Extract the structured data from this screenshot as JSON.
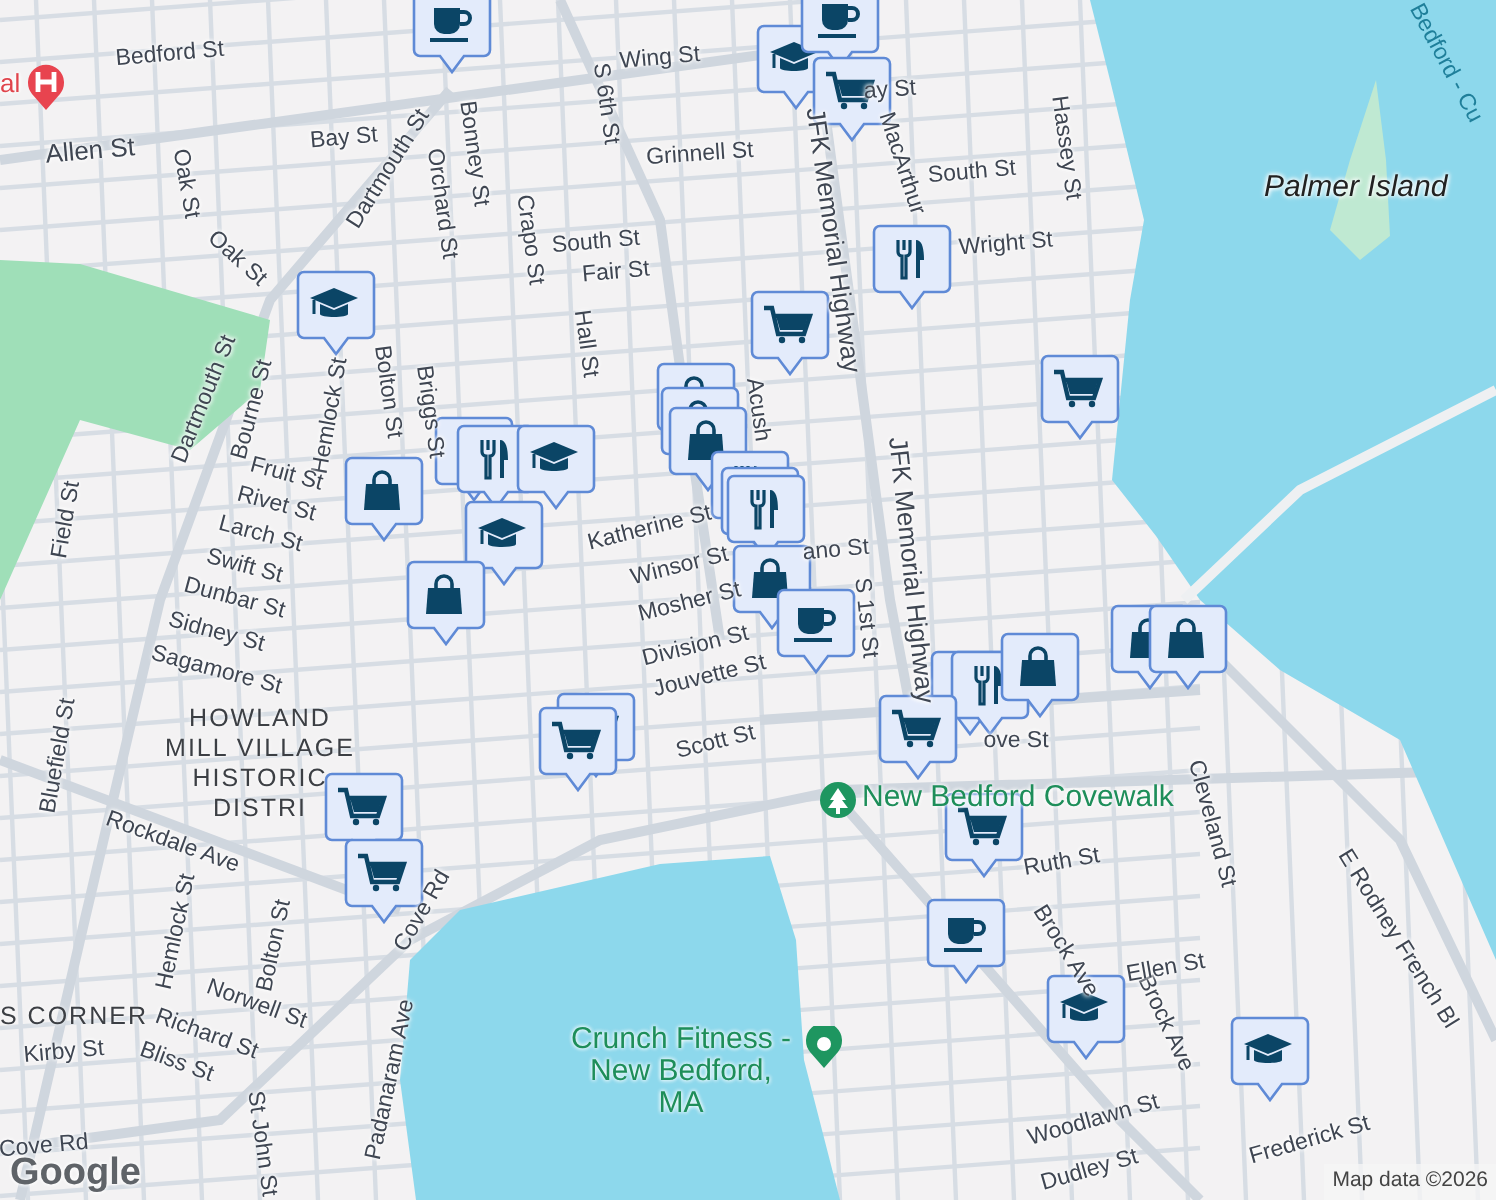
{
  "map": {
    "hospital_label": "al",
    "street_labels": [
      "Bedford St",
      "Allen St",
      "Wing St",
      "S 6th St",
      "Bay St",
      "Dartmouth St",
      "Grinnell St",
      "Oak St",
      "Orchard St",
      "Bonney St",
      "Oak St",
      "Crapo St",
      "South St",
      "Fair St",
      "Hall St",
      "Dartmouth St",
      "Bourne St",
      "Hemlock St",
      "Bolton St",
      "Briggs St",
      "Fruit St",
      "Rivet St",
      "Larch St",
      "Swift St",
      "Dunbar St",
      "Sidney St",
      "Sagamore St",
      "Field St",
      "Katherine St",
      "Winsor St",
      "Mosher St",
      "Division St",
      "Jouvette St",
      "Scott St",
      "Bluefield St",
      "Rockdale Ave",
      "Hemlock St",
      "Bolton St",
      "Norwell St",
      "Richard St",
      "Bliss St",
      "Kirby St",
      "Cove Rd",
      "Padanaram Ave",
      "Cove Rd",
      "St John St",
      "ay St",
      "MacArthur",
      "Hassey St",
      "South St",
      "JFK Memorial Highway",
      "Wright St",
      "Acush",
      "JFK Memorial Highway",
      "ano St",
      "S 1st St",
      "ove St",
      "Ruth St",
      "Cleveland St",
      "E Rodney French Bl",
      "Brock Ave",
      "Brock Ave",
      "Ellen St",
      "Woodlawn St",
      "Dudley St",
      "Frederick St"
    ],
    "ferry_label": "Bedford - Cu",
    "island_label": "Palmer Island",
    "district_label": [
      "HOWLAND",
      "MILL VILLAGE",
      "HISTORIC",
      "DISTRI"
    ],
    "corner_label": "S CORNER",
    "places": [
      {
        "kind": "park",
        "name": "New Bedford Covewalk"
      },
      {
        "kind": "gym",
        "name": "Crunch Fitness - New Bedford, MA"
      }
    ],
    "markers": [
      {
        "kind": "cafe"
      },
      {
        "kind": "school"
      },
      {
        "kind": "cafe"
      },
      {
        "kind": "cart"
      },
      {
        "kind": "restaurant"
      },
      {
        "kind": "cart"
      },
      {
        "kind": "cart"
      },
      {
        "kind": "school"
      },
      {
        "kind": "bag"
      },
      {
        "kind": "bag"
      },
      {
        "kind": "bag"
      },
      {
        "kind": "restaurant"
      },
      {
        "kind": "restaurant"
      },
      {
        "kind": "school"
      },
      {
        "kind": "bag"
      },
      {
        "kind": "school"
      },
      {
        "kind": "bag"
      },
      {
        "kind": "restaurant"
      },
      {
        "kind": "restaurant"
      },
      {
        "kind": "restaurant"
      },
      {
        "kind": "bag"
      },
      {
        "kind": "cafe"
      },
      {
        "kind": "cart"
      },
      {
        "kind": "cart"
      },
      {
        "kind": "cart"
      },
      {
        "kind": "cart"
      },
      {
        "kind": "restaurant"
      },
      {
        "kind": "restaurant"
      },
      {
        "kind": "bag"
      },
      {
        "kind": "bag"
      },
      {
        "kind": "bag"
      },
      {
        "kind": "cart"
      },
      {
        "kind": "cart"
      },
      {
        "kind": "cafe"
      },
      {
        "kind": "school"
      },
      {
        "kind": "school"
      }
    ],
    "logo": "Google",
    "attribution": "Map data ©2026"
  }
}
